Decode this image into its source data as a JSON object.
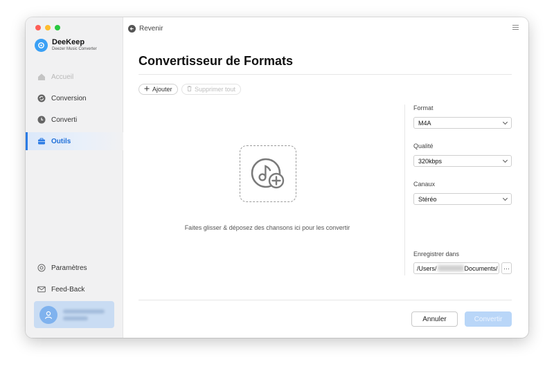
{
  "app": {
    "name": "DeeKeep",
    "subtitle": "Deezer Music Converter"
  },
  "sidebar": {
    "items": [
      {
        "label": "Accueil",
        "icon": "home-icon",
        "state": "disabled"
      },
      {
        "label": "Conversion",
        "icon": "conversion-icon",
        "state": "normal"
      },
      {
        "label": "Converti",
        "icon": "clock-icon",
        "state": "normal"
      },
      {
        "label": "Outils",
        "icon": "toolbox-icon",
        "state": "active"
      }
    ],
    "bottom_items": [
      {
        "label": "Paramètres",
        "icon": "gear-icon"
      },
      {
        "label": "Feed-Back",
        "icon": "mail-icon"
      }
    ]
  },
  "header": {
    "back_label": "Revenir"
  },
  "main": {
    "title": "Convertisseur de Formats",
    "add_label": "Ajouter",
    "remove_all_label": "Supprimer tout",
    "drop_hint": "Faites glisser & déposez des chansons ici pour les convertir"
  },
  "settings": {
    "format_label": "Format",
    "format_value": "M4A",
    "quality_label": "Qualité",
    "quality_value": "320kbps",
    "channels_label": "Canaux",
    "channels_value": "Stéréo",
    "save_label": "Enregistrer dans",
    "save_path_start": "/Users/",
    "save_path_end": "Documents/",
    "browse_label": "···"
  },
  "footer": {
    "cancel_label": "Annuler",
    "convert_label": "Convertir"
  },
  "colors": {
    "accent": "#2b7be4",
    "active_bg": "#dbe8fa",
    "convert_disabled": "#b9d6f8"
  }
}
